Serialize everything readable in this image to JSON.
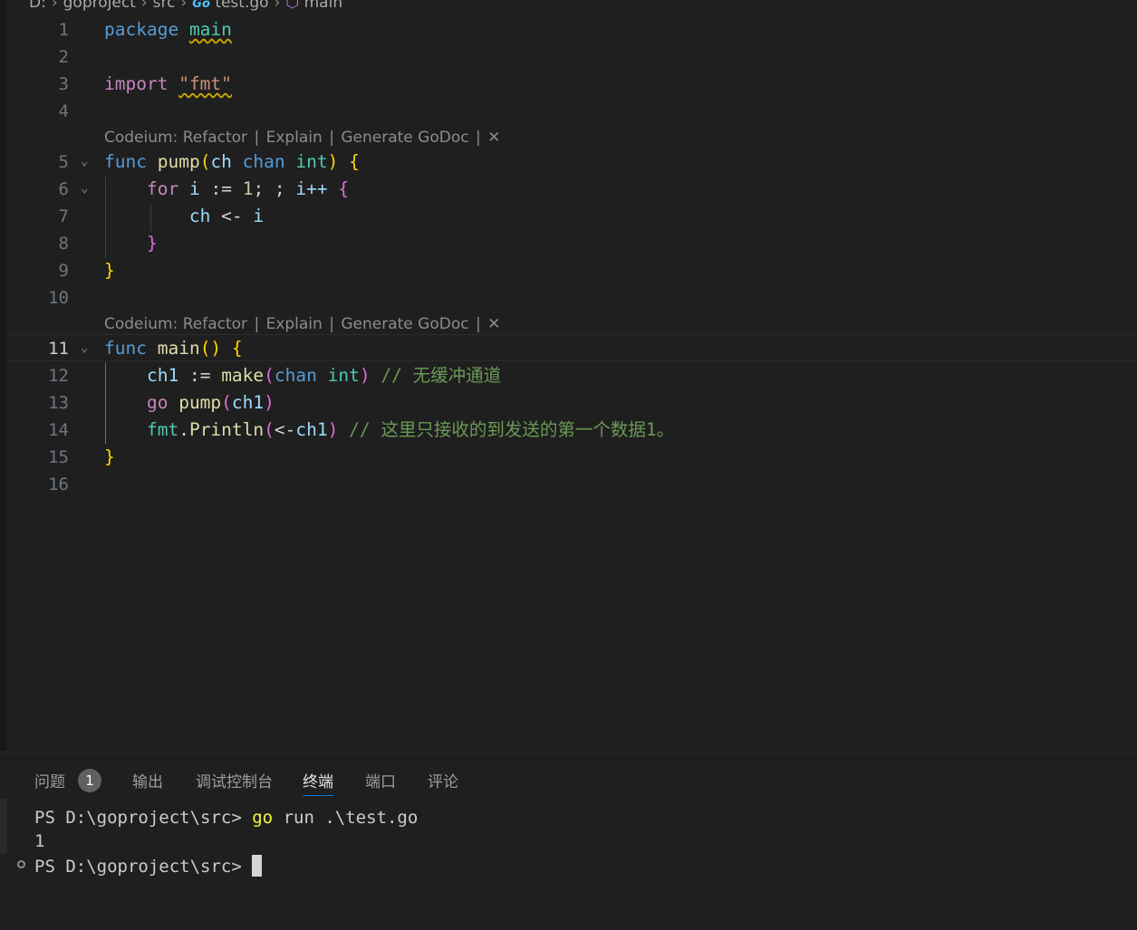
{
  "breadcrumb": {
    "drive": "D:",
    "folder1": "goproject",
    "folder2": "src",
    "file_icon": "Go",
    "file": "test.go",
    "symbol": "main"
  },
  "editor": {
    "active_line": "11",
    "lines": [
      {
        "num": "1"
      },
      {
        "num": "2"
      },
      {
        "num": "3"
      },
      {
        "num": "4"
      },
      {
        "num": "5"
      },
      {
        "num": "6"
      },
      {
        "num": "7"
      },
      {
        "num": "8"
      },
      {
        "num": "9"
      },
      {
        "num": "10"
      },
      {
        "num": "11"
      },
      {
        "num": "12"
      },
      {
        "num": "13"
      },
      {
        "num": "14"
      },
      {
        "num": "15"
      },
      {
        "num": "16"
      }
    ],
    "codelens": {
      "prefix": "Codeium:",
      "refactor": "Refactor",
      "explain": "Explain",
      "godoc": "Generate GoDoc",
      "sep": "|"
    },
    "tokens": {
      "package": "package",
      "main": "main",
      "import": "import",
      "fmt_str": "\"fmt\"",
      "func": "func",
      "pump": "pump",
      "ch": "ch",
      "chan": "chan",
      "int": "int",
      "for": "for",
      "i": "i",
      "assign": ":=",
      "one": "1",
      "for_sep": "; ;",
      "incr": "i++",
      "send": "<-",
      "ch1": "ch1",
      "make": "make",
      "go": "go",
      "fmt": "fmt",
      "println": "Println",
      "comment1": "// 无缓冲通道",
      "comment2": "// 这里只接收的到发送的第一个数据1。"
    }
  },
  "panel": {
    "tabs": [
      {
        "label": "问题",
        "badge": "1"
      },
      {
        "label": "输出"
      },
      {
        "label": "调试控制台"
      },
      {
        "label": "终端"
      },
      {
        "label": "端口"
      },
      {
        "label": "评论"
      }
    ],
    "active_tab": "终端"
  },
  "terminal": {
    "prompt": "PS D:\\goproject\\src>",
    "cmd_go": "go",
    "cmd_rest": "run .\\test.go",
    "output": "1",
    "prompt2": "PS D:\\goproject\\src>"
  }
}
